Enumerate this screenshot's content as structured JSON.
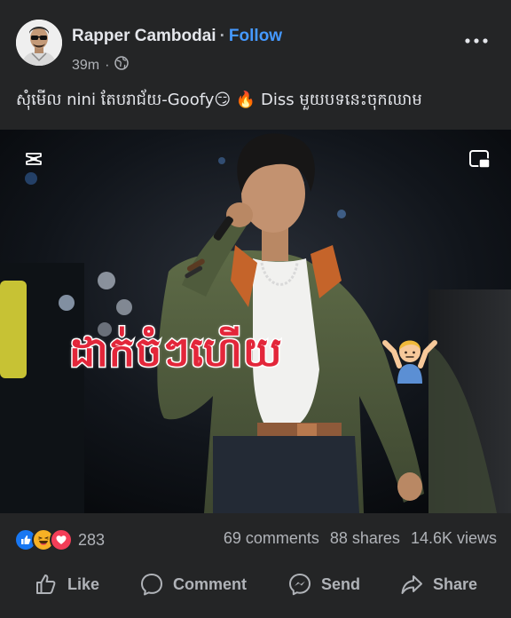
{
  "post": {
    "author": "Rapper Cambodai",
    "separator": "·",
    "follow_label": "Follow",
    "time": "39m",
    "meta_separator": "·",
    "privacy_icon": "globe-icon",
    "caption_text": "សុំមើល nini តែបរាជ័យ-Goofy",
    "caption_emoji_1": "😏",
    "caption_emoji_2": "🔥",
    "caption_tail": "Diss មួយបទនេះចុកឈាម"
  },
  "video": {
    "overlay_text": "ដាក់ចំៗហើយ",
    "overlay_emoji": "man-shrugging",
    "overlay_color": "#e3263a",
    "capcut_icon": "capcut-icon",
    "pip_icon": "picture-in-picture-icon"
  },
  "stats": {
    "reaction_count": "283",
    "reactions": [
      "like",
      "haha",
      "love"
    ],
    "comments": "69 comments",
    "shares": "88 shares",
    "views": "14.6K views"
  },
  "actions": {
    "like": "Like",
    "comment": "Comment",
    "send": "Send",
    "share": "Share"
  },
  "colors": {
    "background": "#242526",
    "text_primary": "#e4e6eb",
    "text_secondary": "#b0b3b8",
    "follow_blue": "#4599ff",
    "like_blue": "#1877f2",
    "love_red": "#f33e58",
    "haha_yellow": "#f7b125"
  }
}
